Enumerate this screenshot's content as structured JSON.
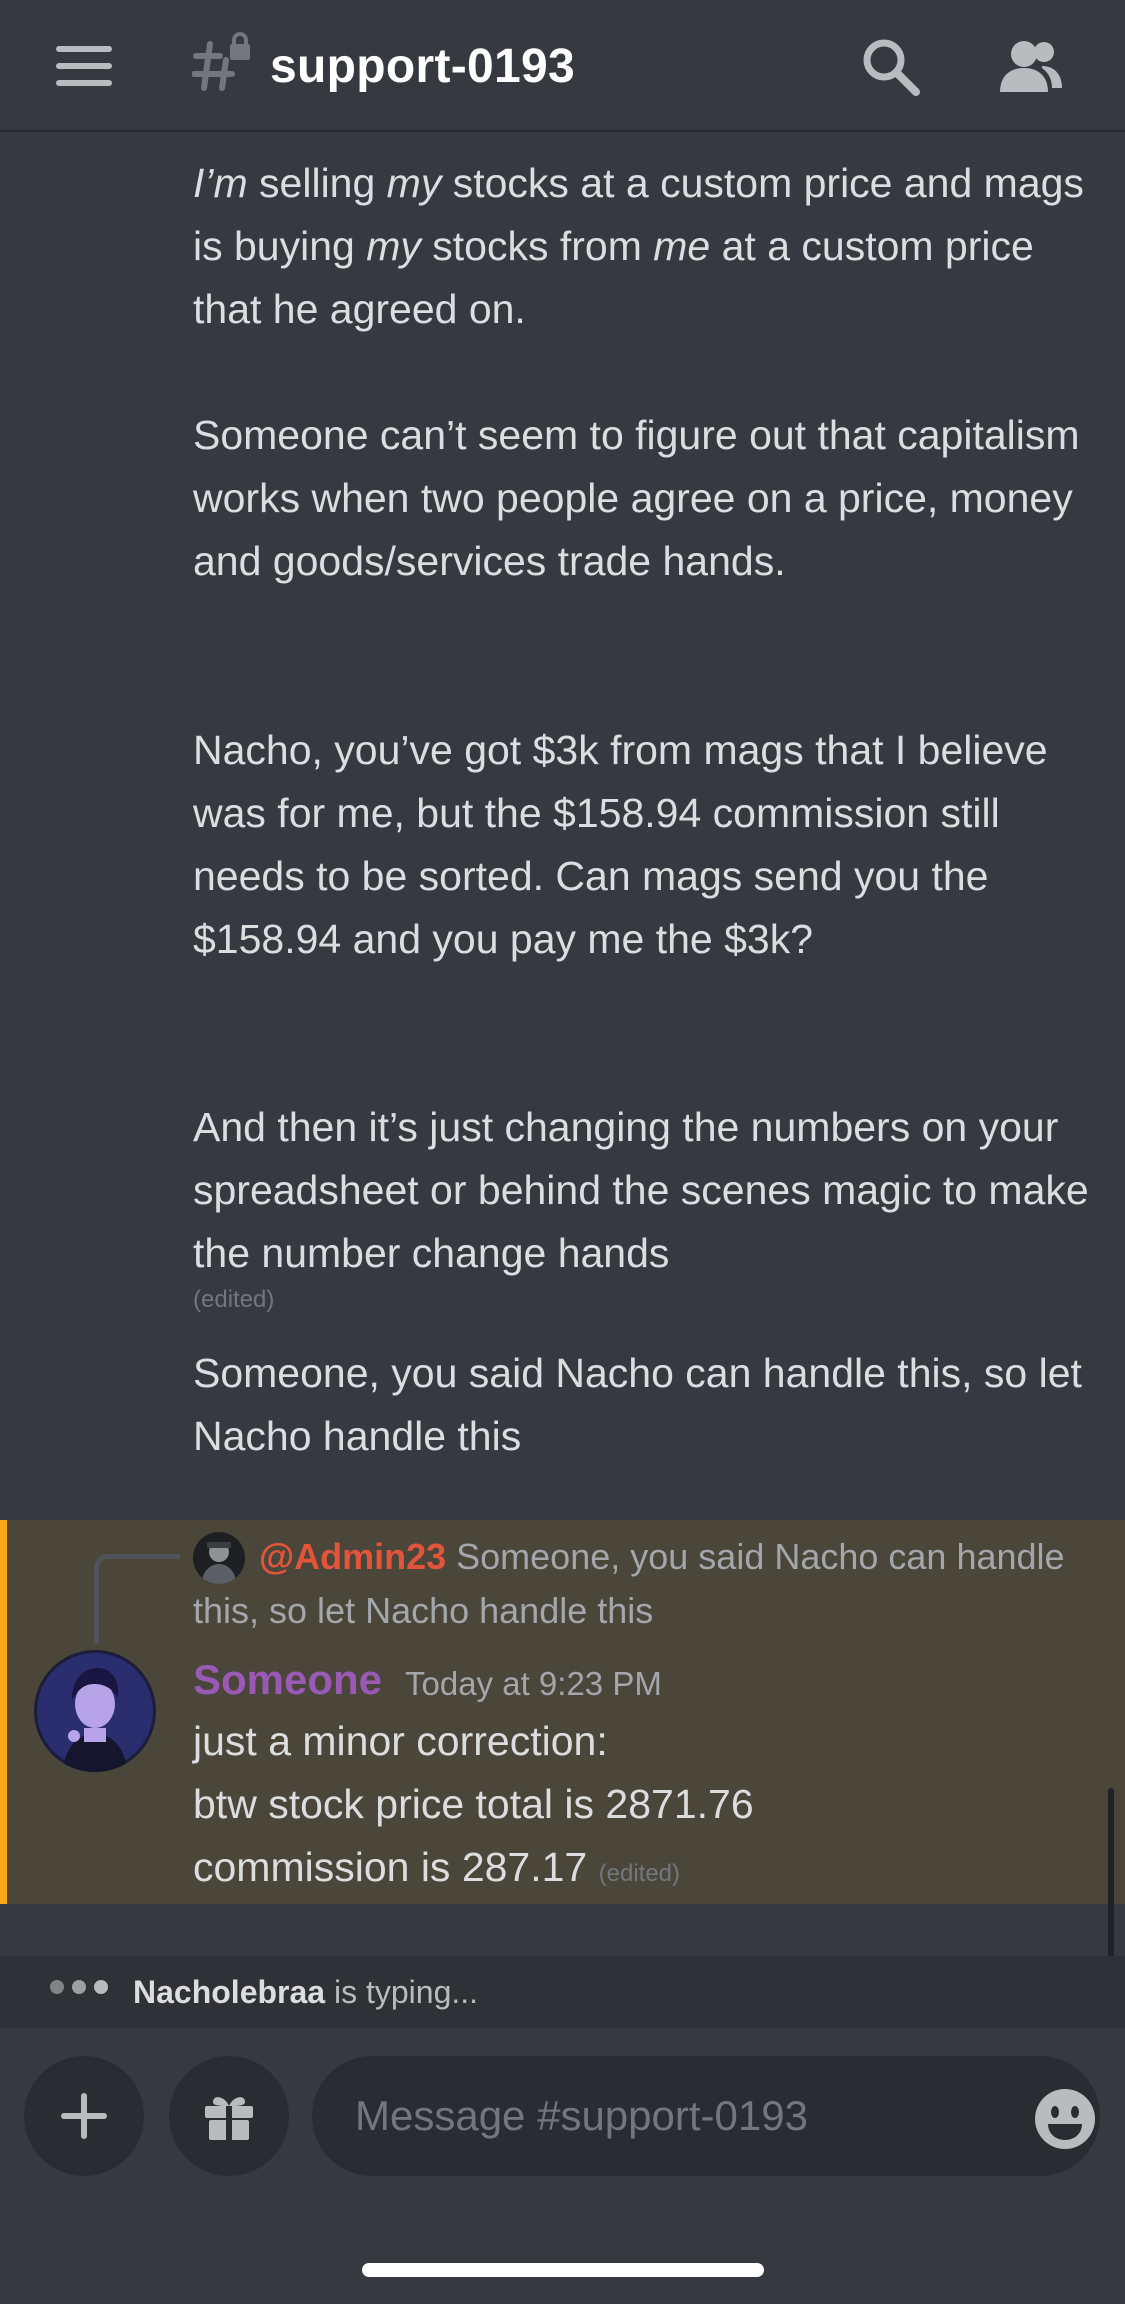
{
  "header": {
    "channel_name": "support-0193"
  },
  "messages": {
    "block1_parts": [
      {
        "t": "I’m",
        "i": true
      },
      {
        "t": " selling ",
        "i": false
      },
      {
        "t": "my",
        "i": true
      },
      {
        "t": " stocks at a custom price and mags is buying ",
        "i": false
      },
      {
        "t": "my",
        "i": true
      },
      {
        "t": " stocks from ",
        "i": false
      },
      {
        "t": "me",
        "i": true
      },
      {
        "t": " at a custom price that he agreed on.",
        "i": false
      }
    ],
    "block2": "Someone can’t seem to figure out that capitalism works when two people agree on a price, money and goods/services trade hands.",
    "block3": "Nacho, you’ve got $3k from mags that I believe was for me, but the $158.94 commission still needs to be sorted. Can mags send you the $158.94 and you pay me the $3k?",
    "block4": "And then it’s just changing the numbers on your spreadsheet or behind the scenes magic to make the number change hands",
    "block4_edited": "(edited)",
    "block5": "Someone, you said Nacho can handle this, so let Nacho handle this"
  },
  "mention_message": {
    "reply_mention": "@Admin23",
    "reply_text": "Someone, you said Nacho can handle this, so let Nacho handle this",
    "author": "Someone",
    "timestamp": "Today at 9:23 PM",
    "lines": [
      "just a minor correction:",
      "btw stock price total is 2871.76",
      "commission is 287.17"
    ],
    "edited": "(edited)"
  },
  "typing": {
    "user": "Nacholebraa",
    "suffix": " is typing..."
  },
  "composer": {
    "placeholder": "Message #support-0193"
  },
  "colors": {
    "author": "#9b59b6",
    "mention": "#e2553a",
    "highlight_bg": "#4a4639",
    "highlight_bar": "#faa81a"
  },
  "icons": [
    "menu-icon",
    "locked-channel-icon",
    "search-icon",
    "members-icon",
    "plus-icon",
    "gift-icon",
    "emoji-icon"
  ]
}
